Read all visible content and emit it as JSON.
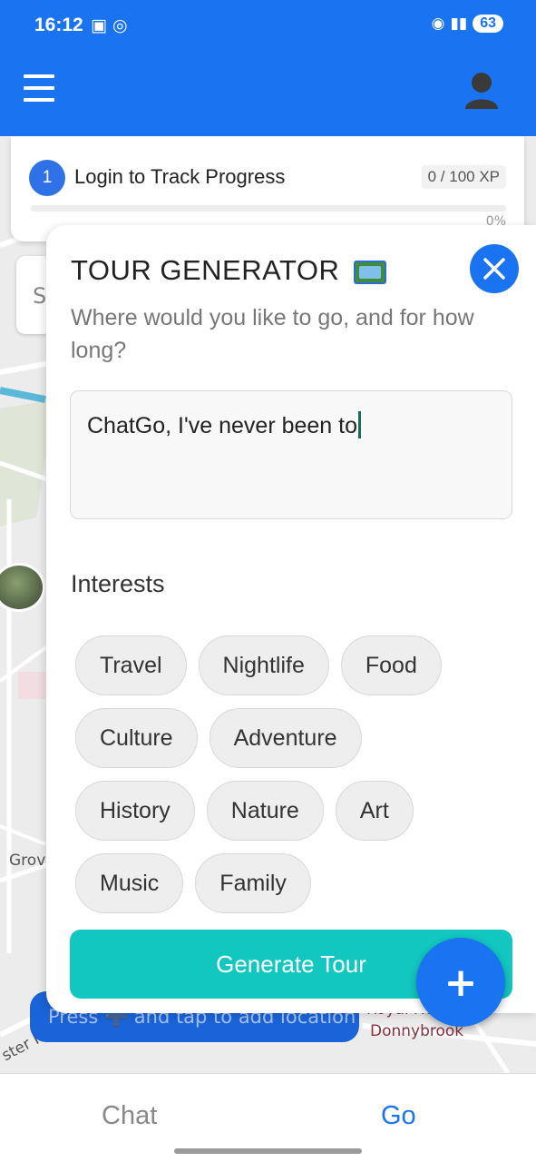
{
  "status_bar": {
    "time": "16:12",
    "notification_icons": "▣ ◎",
    "battery": "63"
  },
  "header": {
    "menu_icon": "hamburger-icon",
    "profile_icon": "user-avatar-icon",
    "color": "#1a73f0"
  },
  "progress": {
    "step": "1",
    "title": "Login to Track Progress",
    "xp": "0 / 100 XP",
    "percent_label": "0%",
    "percent": 0
  },
  "map": {
    "search_stub": "S",
    "labels": [
      "Grov",
      "ster Rd",
      "Royal Ho",
      "Donnybrook"
    ]
  },
  "location_toast": {
    "text": "Press ➕ and tap to add location"
  },
  "tour_generator": {
    "title": "TOUR GENERATOR",
    "title_icon": "world-map-icon",
    "subtitle": "Where would you like to go, and for how long?",
    "prompt_value": "ChatGo, I've never been to",
    "interests_label": "Interests",
    "interests": [
      [
        "Travel",
        "Nightlife",
        "Food"
      ],
      [
        "Culture",
        "Adventure"
      ],
      [
        "History",
        "Nature",
        "Art"
      ],
      [
        "Music",
        "Family"
      ]
    ],
    "generate_label": "Generate Tour",
    "accent": "#11c7bf"
  },
  "fab": {
    "label": "+"
  },
  "bottom_nav": {
    "tabs": [
      "Chat",
      "Go"
    ],
    "active": "Go"
  }
}
